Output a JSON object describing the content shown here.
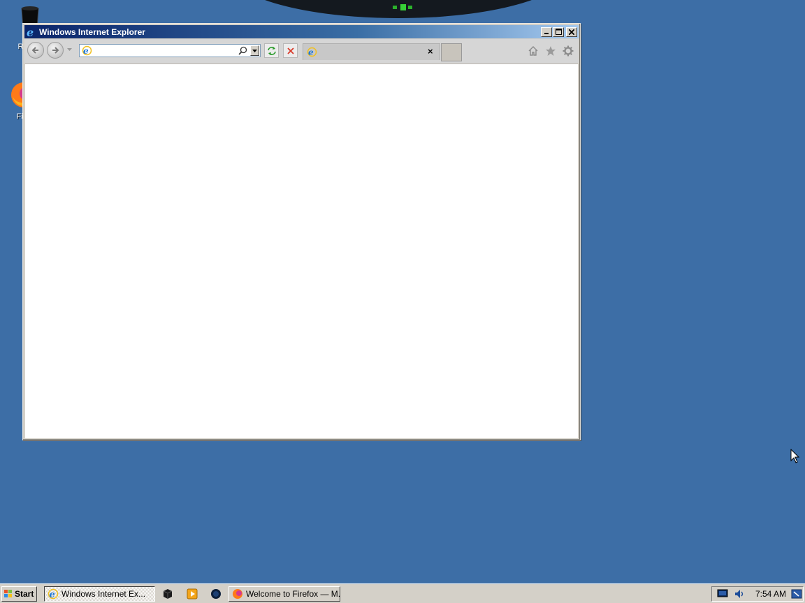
{
  "desktop": {
    "icons": [
      {
        "label": "Recy",
        "icon": "recycle-bin-icon"
      },
      {
        "label": "Fir",
        "icon": "firefox-icon"
      }
    ]
  },
  "window": {
    "title": "Windows Internet Explorer",
    "address": {
      "value": "",
      "placeholder": ""
    },
    "tab": {
      "label": "",
      "close": "×"
    },
    "buttons": {
      "minimize": "minimize-icon",
      "maximize": "maximize-icon",
      "close": "close-icon",
      "refresh": "refresh-icon",
      "stop": "stop-icon",
      "home": "home-icon",
      "favorites": "star-icon",
      "tools": "gear-icon"
    }
  },
  "taskbar": {
    "start_label": "Start",
    "tasks": [
      {
        "label": "Windows Internet Ex...",
        "active": true,
        "icon": "ie-icon"
      },
      {
        "label": "Welcome to Firefox — M...",
        "active": false,
        "icon": "firefox-icon"
      }
    ],
    "quick_launch": [
      "terminal-icon",
      "media-player-icon",
      "globe-icon"
    ],
    "clock": "7:54 AM"
  },
  "colors": {
    "desktop": "#3d6ea6",
    "titlebar_start": "#0a246a",
    "titlebar_end": "#a6caf0",
    "chrome": "#d4d0c8"
  }
}
